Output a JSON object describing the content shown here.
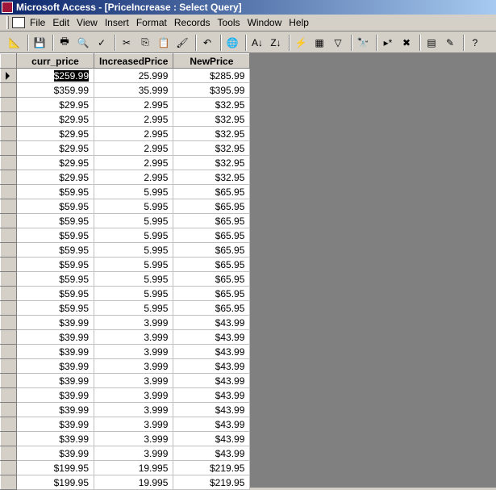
{
  "window": {
    "title": "Microsoft Access - [PriceIncrease : Select Query]"
  },
  "menu": [
    "File",
    "Edit",
    "View",
    "Insert",
    "Format",
    "Records",
    "Tools",
    "Window",
    "Help"
  ],
  "toolbar": [
    "view-icon",
    "save-icon",
    "print-icon",
    "print-preview-icon",
    "spelling-icon",
    "cut-icon",
    "copy-icon",
    "paste-icon",
    "format-painter-icon",
    "undo-icon",
    "hyperlink-icon",
    "sort-ascending-icon",
    "sort-descending-icon",
    "filter-by-selection-icon",
    "filter-by-form-icon",
    "apply-filter-icon",
    "find-icon",
    "new-record-icon",
    "delete-record-icon",
    "database-window-icon",
    "new-object-icon",
    "help-icon"
  ],
  "columns": [
    "curr_price",
    "IncreasedPrice",
    "NewPrice"
  ],
  "rows": [
    [
      "$259.99",
      "25.999",
      "$285.99"
    ],
    [
      "$359.99",
      "35.999",
      "$395.99"
    ],
    [
      "$29.95",
      "2.995",
      "$32.95"
    ],
    [
      "$29.95",
      "2.995",
      "$32.95"
    ],
    [
      "$29.95",
      "2.995",
      "$32.95"
    ],
    [
      "$29.95",
      "2.995",
      "$32.95"
    ],
    [
      "$29.95",
      "2.995",
      "$32.95"
    ],
    [
      "$29.95",
      "2.995",
      "$32.95"
    ],
    [
      "$59.95",
      "5.995",
      "$65.95"
    ],
    [
      "$59.95",
      "5.995",
      "$65.95"
    ],
    [
      "$59.95",
      "5.995",
      "$65.95"
    ],
    [
      "$59.95",
      "5.995",
      "$65.95"
    ],
    [
      "$59.95",
      "5.995",
      "$65.95"
    ],
    [
      "$59.95",
      "5.995",
      "$65.95"
    ],
    [
      "$59.95",
      "5.995",
      "$65.95"
    ],
    [
      "$59.95",
      "5.995",
      "$65.95"
    ],
    [
      "$59.95",
      "5.995",
      "$65.95"
    ],
    [
      "$39.99",
      "3.999",
      "$43.99"
    ],
    [
      "$39.99",
      "3.999",
      "$43.99"
    ],
    [
      "$39.99",
      "3.999",
      "$43.99"
    ],
    [
      "$39.99",
      "3.999",
      "$43.99"
    ],
    [
      "$39.99",
      "3.999",
      "$43.99"
    ],
    [
      "$39.99",
      "3.999",
      "$43.99"
    ],
    [
      "$39.99",
      "3.999",
      "$43.99"
    ],
    [
      "$39.99",
      "3.999",
      "$43.99"
    ],
    [
      "$39.99",
      "3.999",
      "$43.99"
    ],
    [
      "$39.99",
      "3.999",
      "$43.99"
    ],
    [
      "$199.95",
      "19.995",
      "$219.95"
    ],
    [
      "$199.95",
      "19.995",
      "$219.95"
    ]
  ]
}
